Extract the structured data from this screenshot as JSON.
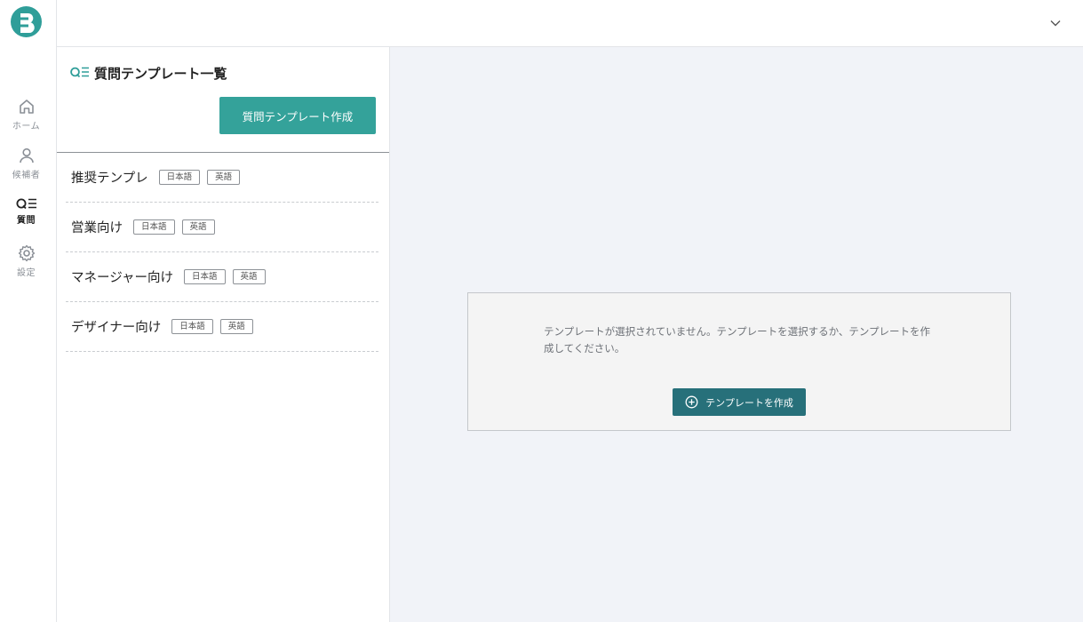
{
  "nav": {
    "items": [
      {
        "label": "ホーム",
        "icon": "home-icon"
      },
      {
        "label": "候補者",
        "icon": "user-icon"
      },
      {
        "label": "質問",
        "icon": "question-list-icon"
      },
      {
        "label": "設定",
        "icon": "gear-icon"
      }
    ],
    "active": "質問"
  },
  "list_panel": {
    "title": "質問テンプレート一覧",
    "create_label": "質問テンプレート作成",
    "templates": [
      {
        "name": "推奨テンプレ",
        "tags": [
          "日本語",
          "英語"
        ]
      },
      {
        "name": "営業向け",
        "tags": [
          "日本語",
          "英語"
        ]
      },
      {
        "name": "マネージャー向け",
        "tags": [
          "日本語",
          "英語"
        ]
      },
      {
        "name": "デザイナー向け",
        "tags": [
          "日本語",
          "英語"
        ]
      }
    ]
  },
  "detail": {
    "empty_message": "テンプレートが選択されていません。テンプレートを選択するか、テンプレートを作成してください。",
    "create_label": "テンプレートを作成"
  },
  "colors": {
    "brand": "#2f9e99",
    "primary_button": "#34a29a",
    "secondary_button": "#27707a",
    "detail_background": "#f1f3f8"
  }
}
